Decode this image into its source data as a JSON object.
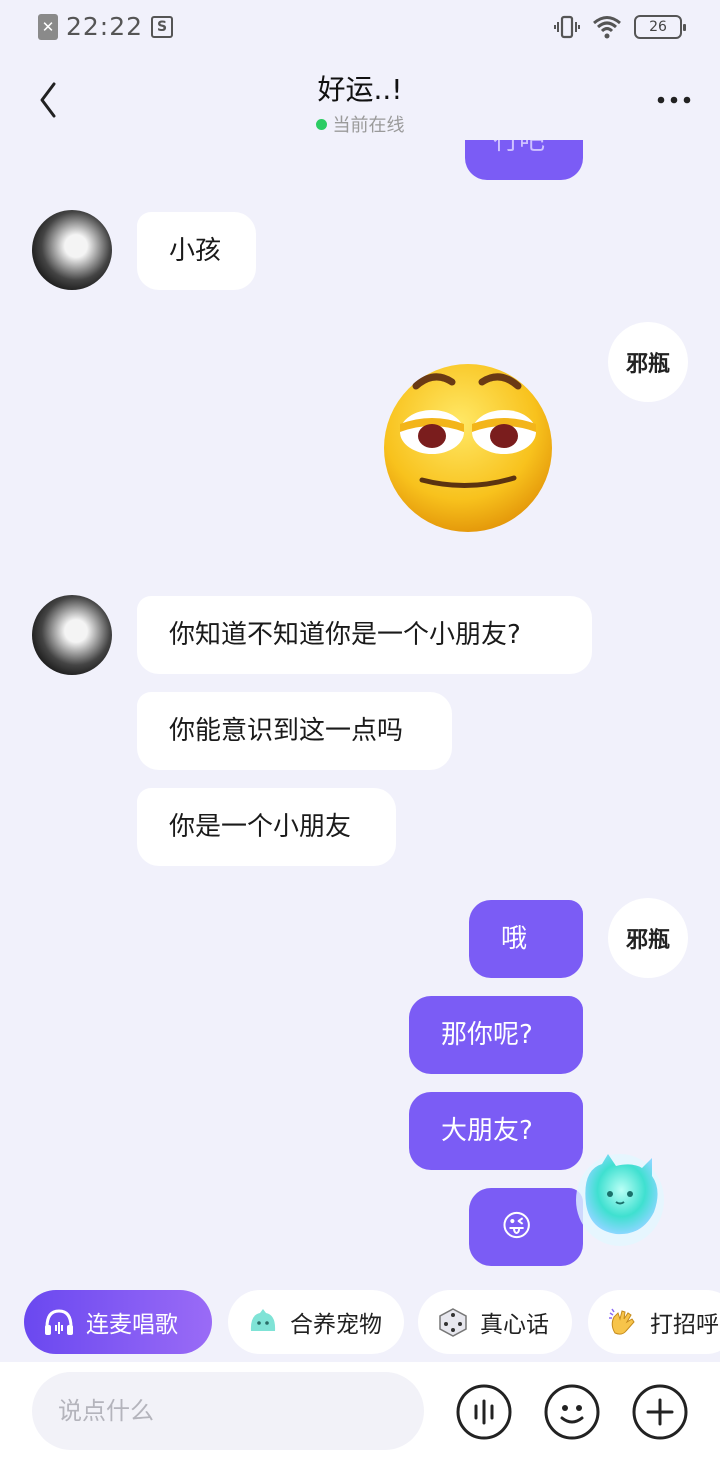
{
  "status_bar": {
    "time": "22:22",
    "battery": "26"
  },
  "header": {
    "title": "好运..!",
    "status": "当前在线"
  },
  "self_avatar_text": "邪瓶",
  "messages": {
    "partial_top": "行吧",
    "m1": "小孩",
    "m2": "你知道不知道你是一个小朋友?",
    "m3": "你能意识到这一点吗",
    "m4": "你是一个小朋友",
    "m5": "哦",
    "m6": "那你呢?",
    "m7": "大朋友?",
    "m8": "😜"
  },
  "quick_actions": [
    {
      "label": "连麦唱歌"
    },
    {
      "label": "合养宠物"
    },
    {
      "label": "真心话"
    },
    {
      "label": "打招呼"
    }
  ],
  "input": {
    "placeholder": "说点什么"
  },
  "colors": {
    "accent": "#7b5cf5",
    "online": "#2ccc63",
    "background": "#f1f1fb"
  }
}
